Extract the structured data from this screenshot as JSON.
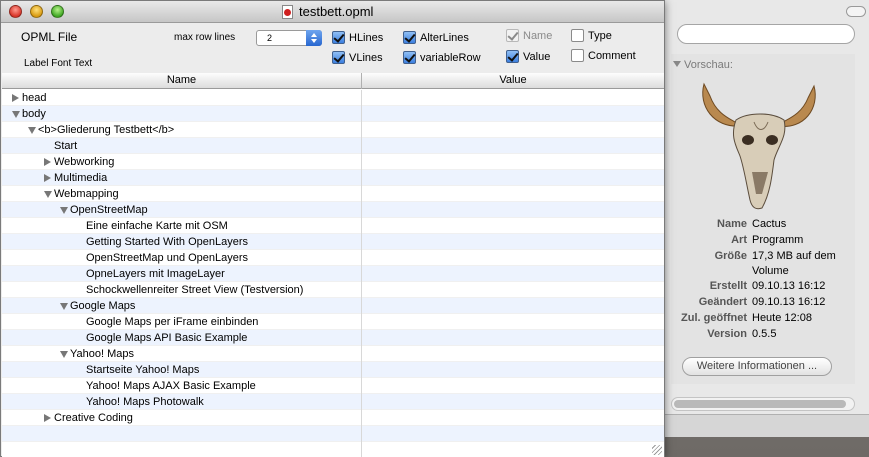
{
  "window": {
    "title": "testbett.opml"
  },
  "toolbar": {
    "opml_label": "OPML File",
    "label_font": "Label Font Text",
    "rows_label": "max row lines",
    "rows_value": "2",
    "checkboxes": {
      "hlines": {
        "label": "HLines",
        "checked": true
      },
      "vlines": {
        "label": "VLines",
        "checked": true
      },
      "alterlines": {
        "label": "AlterLines",
        "checked": true
      },
      "variablerow": {
        "label": "variableRow",
        "checked": true
      },
      "name": {
        "label": "Name",
        "checked": true,
        "disabled": true
      },
      "value": {
        "label": "Value",
        "checked": true
      },
      "type": {
        "label": "Type",
        "checked": false
      },
      "comment": {
        "label": "Comment",
        "checked": false
      }
    }
  },
  "table": {
    "headers": {
      "name": "Name",
      "value": "Value"
    },
    "rows": [
      {
        "label": "head",
        "level": 0,
        "disclosure": "closed"
      },
      {
        "label": "body",
        "level": 0,
        "disclosure": "open"
      },
      {
        "label": "<b>Gliederung Testbett</b>",
        "level": 1,
        "disclosure": "open"
      },
      {
        "label": "Start",
        "level": 2,
        "disclosure": "none"
      },
      {
        "label": "Webworking",
        "level": 2,
        "disclosure": "closed"
      },
      {
        "label": "Multimedia",
        "level": 2,
        "disclosure": "closed"
      },
      {
        "label": "Webmapping",
        "level": 2,
        "disclosure": "open"
      },
      {
        "label": "OpenStreetMap",
        "level": 3,
        "disclosure": "open"
      },
      {
        "label": "Eine einfache Karte mit OSM",
        "level": 4,
        "disclosure": "none"
      },
      {
        "label": "Getting Started With OpenLayers",
        "level": 4,
        "disclosure": "none"
      },
      {
        "label": "OpenStreetMap und OpenLayers",
        "level": 4,
        "disclosure": "none"
      },
      {
        "label": "OpneLayers mit ImageLayer",
        "level": 4,
        "disclosure": "none"
      },
      {
        "label": "Schockwellenreiter Street View (Testversion)",
        "level": 4,
        "disclosure": "none"
      },
      {
        "label": "Google Maps",
        "level": 3,
        "disclosure": "open"
      },
      {
        "label": "Google Maps per iFrame einbinden",
        "level": 4,
        "disclosure": "none"
      },
      {
        "label": "Google Maps API Basic Example",
        "level": 4,
        "disclosure": "none"
      },
      {
        "label": "Yahoo! Maps",
        "level": 3,
        "disclosure": "open"
      },
      {
        "label": "Startseite Yahoo! Maps",
        "level": 4,
        "disclosure": "none"
      },
      {
        "label": "Yahoo! Maps AJAX Basic Example",
        "level": 4,
        "disclosure": "none"
      },
      {
        "label": "Yahoo! Maps Photowalk",
        "level": 4,
        "disclosure": "none"
      },
      {
        "label": "Creative Coding",
        "level": 2,
        "disclosure": "closed"
      },
      {
        "label": "",
        "level": 0,
        "disclosure": "none"
      },
      {
        "label": "",
        "level": 0,
        "disclosure": "none"
      }
    ]
  },
  "finder": {
    "preview_label": "Vorschau:",
    "info": [
      {
        "key": "Name",
        "value": "Cactus"
      },
      {
        "key": "Art",
        "value": "Programm"
      },
      {
        "key": "Größe",
        "value": "17,3 MB auf dem Volume"
      },
      {
        "key": "Erstellt",
        "value": "09.10.13 16:12"
      },
      {
        "key": "Geändert",
        "value": "09.10.13 16:12"
      },
      {
        "key": "Zul. geöffnet",
        "value": "Heute 12:08"
      },
      {
        "key": "Version",
        "value": "0.5.5"
      }
    ],
    "more_button": "Weitere Informationen ..."
  }
}
